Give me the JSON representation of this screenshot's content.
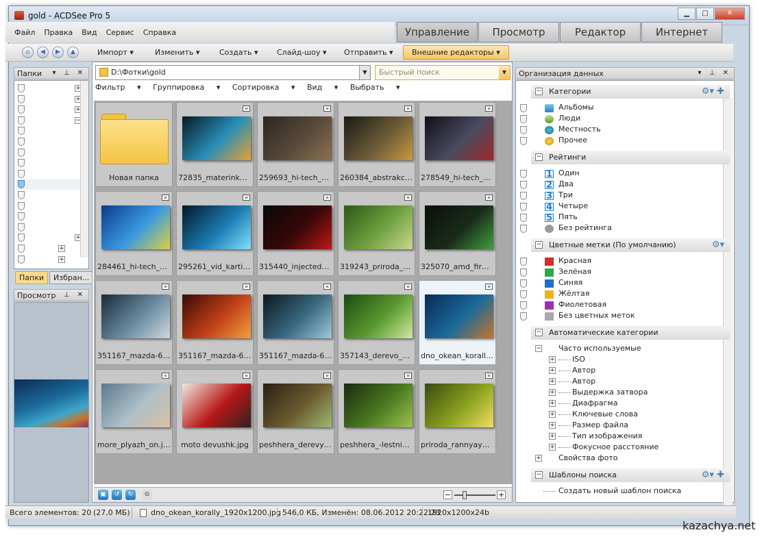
{
  "window": {
    "title": "gold - ACDSee Pro 5"
  },
  "menu": [
    "Файл",
    "Правка",
    "Вид",
    "Сервис",
    "Справка"
  ],
  "modes": [
    "Управление",
    "Просмотр",
    "Редактор",
    "Интернет"
  ],
  "toolbar": {
    "import": "Импорт",
    "edit": "Изменить",
    "create": "Создать",
    "slideshow": "Слайд-шоу",
    "send": "Отправить",
    "external": "Внешние редакторы"
  },
  "left_panel": {
    "title": "Папки",
    "tabs": [
      "Папки",
      "Избран..."
    ],
    "preview_title": "Просмотр"
  },
  "path": {
    "value": "D:\\Фотки\\gold",
    "search_placeholder": "Быстрый поиск"
  },
  "filterbar": [
    "Фильтр",
    "Группировка",
    "Сортировка",
    "Вид",
    "Выбрать"
  ],
  "thumbnails": [
    {
      "label": "Новая папка",
      "type": "folder"
    },
    {
      "label": "72835_materinka_pr...",
      "type": "image",
      "colors": [
        "#061a26",
        "#2a8fb8",
        "#e6a030"
      ]
    },
    {
      "label": "259693_hi-tech_ko...",
      "type": "image",
      "colors": [
        "#2a2622",
        "#5a4a3a",
        "#8a7050"
      ]
    },
    {
      "label": "260384_abstrakciya_...",
      "type": "image",
      "colors": [
        "#1a1a14",
        "#6a5a38",
        "#c89a40"
      ]
    },
    {
      "label": "278549_hi-tech_ko...",
      "type": "image",
      "colors": [
        "#101018",
        "#4a4a60",
        "#a02828"
      ]
    },
    {
      "label": "284461_hi-tech_yele...",
      "type": "image",
      "colors": [
        "#0a3a8a",
        "#3a9ae0",
        "#e0d040"
      ]
    },
    {
      "label": "295261_vid_kartinka...",
      "type": "image",
      "colors": [
        "#041828",
        "#1a7ab0",
        "#80e0ff"
      ]
    },
    {
      "label": "315440_injected_kre...",
      "type": "image",
      "colors": [
        "#080808",
        "#3a0808",
        "#c01818"
      ]
    },
    {
      "label": "319243_priroda_dor...",
      "type": "image",
      "colors": [
        "#2a5a18",
        "#70a040",
        "#c8d890"
      ]
    },
    {
      "label": "325070_amd_firma_...",
      "type": "image",
      "colors": [
        "#0a0f0a",
        "#1a2a1a",
        "#40a040"
      ]
    },
    {
      "label": "351167_mazda-6_de...",
      "type": "image",
      "colors": [
        "#1a2a3a",
        "#6a8aa0",
        "#d0d8e0"
      ]
    },
    {
      "label": "351167_mazda-6_de...",
      "type": "image",
      "colors": [
        "#3a0a04",
        "#c04018",
        "#f0a040"
      ]
    },
    {
      "label": "351167_mazda-6_de...",
      "type": "image",
      "colors": [
        "#0a1820",
        "#3a6880",
        "#a0c8d8"
      ]
    },
    {
      "label": "357143_derevo_park...",
      "type": "image",
      "colors": [
        "#1a4a10",
        "#5a9a30",
        "#d0e8a0"
      ]
    },
    {
      "label": "dno_okean_korally_...",
      "type": "image",
      "colors": [
        "#0a2a55",
        "#1c6a9a",
        "#c8742a"
      ]
    },
    {
      "label": "more_plyazh_on.jpg",
      "type": "image",
      "colors": [
        "#5a7a90",
        "#b0c0c8",
        "#d8c0a0"
      ]
    },
    {
      "label": "moto devushk.jpg",
      "type": "image",
      "colors": [
        "#f0e8e0",
        "#b81818",
        "#302020"
      ]
    },
    {
      "label": "peshhera_derevya_...",
      "type": "image",
      "colors": [
        "#2a2014",
        "#6a5a30",
        "#a0b870"
      ]
    },
    {
      "label": "peshhera_-lestnica_...",
      "type": "image",
      "colors": [
        "#1a2a10",
        "#4a7a20",
        "#a0c050"
      ]
    },
    {
      "label": "priroda_rannyaya.jpg",
      "type": "image",
      "colors": [
        "#3a4a10",
        "#8aa020",
        "#f0e060"
      ]
    }
  ],
  "right_panel": {
    "title": "Организация данных",
    "categories": {
      "title": "Категории",
      "items": [
        "Альбомы",
        "Люди",
        "Местность",
        "Прочее"
      ]
    },
    "ratings": {
      "title": "Рейтинги",
      "items": [
        "Один",
        "Два",
        "Три",
        "Четыре",
        "Пять",
        "Без рейтинга"
      ]
    },
    "color_labels": {
      "title": "Цветные метки (По умолчанию)",
      "items": [
        {
          "label": "Красная",
          "color": "#d62b2b"
        },
        {
          "label": "Зелёная",
          "color": "#2aa84a"
        },
        {
          "label": "Синяя",
          "color": "#1f6fc9"
        },
        {
          "label": "Жёлтая",
          "color": "#f0b21e"
        },
        {
          "label": "Фиолетовая",
          "color": "#9b2fae"
        },
        {
          "label": "Без цветных меток",
          "color": "#a8a8a8"
        }
      ]
    },
    "auto_categories": {
      "title": "Автоматические категории",
      "frequent": "Часто используемые",
      "items": [
        "ISO",
        "Автор",
        "Автор",
        "Выдержка затвора",
        "Диафрагма",
        "Ключевые слова",
        "Размер файла",
        "Тип изображения",
        "Фокусное расстояние"
      ],
      "photo_props": "Свойства фото"
    },
    "search_templates": {
      "title": "Шаблоны поиска",
      "create": "Создать новый шаблон поиска"
    }
  },
  "status": {
    "total": "Всего элементов: 20",
    "size": "(27,0 МБ)",
    "file": "dno_okean_korally_1920x1200.jpg",
    "info": "546,0 КБ, Изменён: 08.06.2012 20:22:23",
    "dims": "1920x1200x24b"
  },
  "watermark": "kazachya.net"
}
